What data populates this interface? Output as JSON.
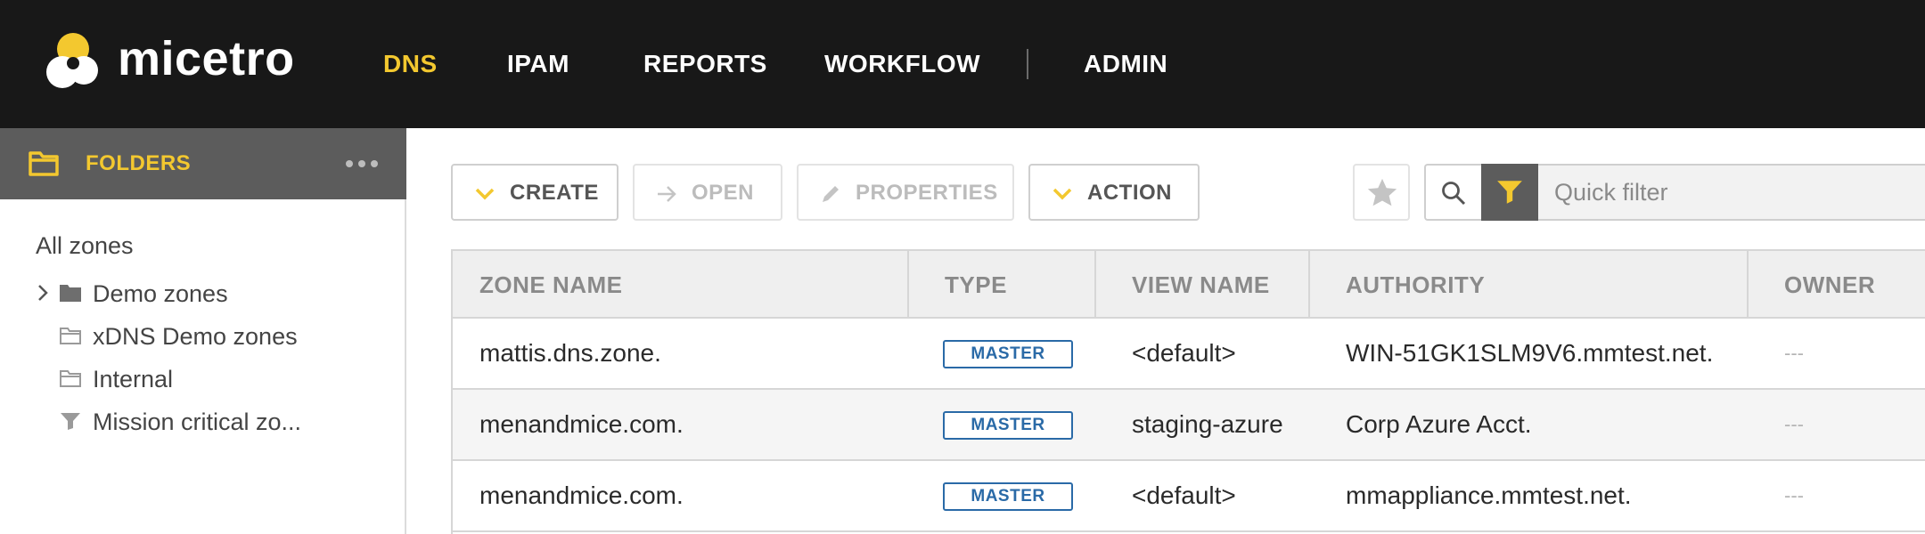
{
  "app": {
    "logo_text": "micetro",
    "brand_color": "#f3c82f"
  },
  "nav": {
    "items": [
      {
        "label": "DNS",
        "active": true
      },
      {
        "label": "IPAM",
        "active": false
      },
      {
        "label": "REPORTS",
        "active": false
      },
      {
        "label": "WORKFLOW",
        "active": false
      },
      {
        "label": "ADMIN",
        "active": false
      }
    ]
  },
  "sidebar": {
    "title": "FOLDERS",
    "title_icon": "folder-icon",
    "more_icon": "more-dots-icon",
    "root_label": "All zones",
    "items": [
      {
        "label": "Demo zones",
        "icon": "folder-filled-icon",
        "expandable": true
      },
      {
        "label": "xDNS Demo zones",
        "icon": "folder-outline-icon",
        "expandable": false
      },
      {
        "label": "Internal",
        "icon": "folder-outline-icon",
        "expandable": false
      },
      {
        "label": "Mission critical zo...",
        "icon": "filter-icon",
        "expandable": false
      }
    ]
  },
  "toolbar": {
    "create_label": "CREATE",
    "open_label": "OPEN",
    "properties_label": "PROPERTIES",
    "action_label": "ACTION",
    "quick_filter_placeholder": "Quick filter"
  },
  "table": {
    "columns": [
      "ZONE NAME",
      "TYPE",
      "VIEW NAME",
      "AUTHORITY",
      "OWNER"
    ],
    "rows": [
      {
        "zone_name": "mattis.dns.zone.",
        "type": "MASTER",
        "view_name": "<default>",
        "authority": "WIN-51GK1SLM9V6.mmtest.net.",
        "owner": "---"
      },
      {
        "zone_name": "menandmice.com.",
        "type": "MASTER",
        "view_name": "staging-azure",
        "authority": "Corp Azure Acct.",
        "owner": "---"
      },
      {
        "zone_name": "menandmice.com.",
        "type": "MASTER",
        "view_name": "<default>",
        "authority": "mmappliance.mmtest.net.",
        "owner": "---"
      }
    ]
  }
}
